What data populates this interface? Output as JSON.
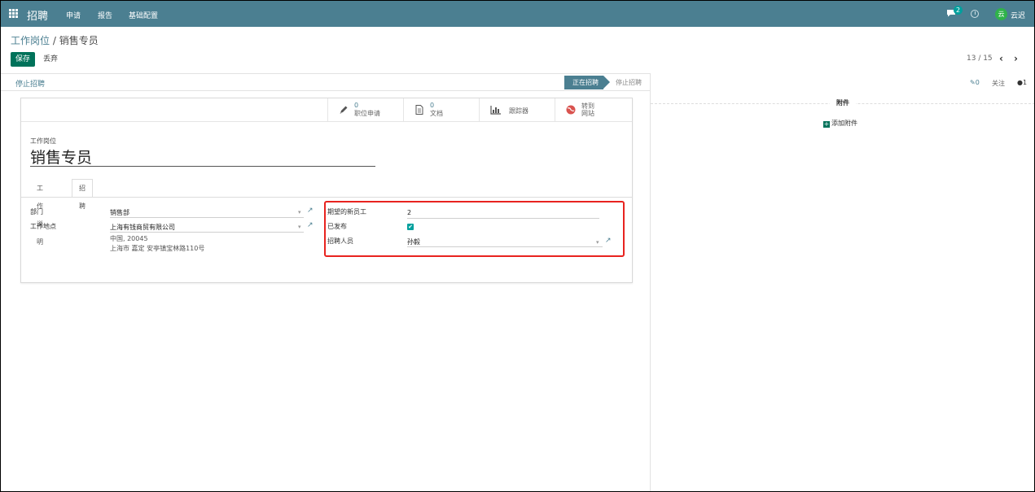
{
  "navbar": {
    "app_title": "招聘",
    "menu": [
      "申请",
      "报告",
      "基础配置"
    ],
    "chat_badge": "2",
    "avatar_text": "云",
    "username": "云迟"
  },
  "breadcrumb": {
    "parent": "工作岗位",
    "separator": " / ",
    "current": "销售专员"
  },
  "actions": {
    "save": "保存",
    "discard": "丢弃"
  },
  "pager": {
    "value": "13 / 15",
    "prev": "‹",
    "next": "›"
  },
  "statusbar": {
    "stop_button": "停止招聘",
    "stage_active": "正在招聘",
    "stage_next": "停止招聘"
  },
  "smart_buttons": {
    "applications": {
      "num": "0",
      "label": "职位申请",
      "icon": "pencil-icon"
    },
    "documents": {
      "num": "0",
      "label": "文档",
      "icon": "file-icon"
    },
    "tracker": {
      "label": "跟踪器",
      "icon": "bar-chart-icon"
    },
    "website": {
      "line1": "转到",
      "line2": "网站",
      "icon": "globe-icon"
    }
  },
  "form": {
    "job_label": "工作岗位",
    "job_title": "销售专员",
    "tabs": [
      "工作说明",
      "招聘"
    ],
    "left": {
      "department_label": "部门",
      "department_value": "销售部",
      "location_label": "工作地点",
      "location_value": "上海有钱商贸有限公司",
      "address_line1": "中国, 20045",
      "address_line2": "上海市 嘉定 安亭镇宝林路110号"
    },
    "right": {
      "expected_label": "期望的新员工",
      "expected_value": "2",
      "published_label": "已发布",
      "published_value": "✔",
      "recruiter_label": "招聘人员",
      "recruiter_value": "孙毅"
    }
  },
  "chatter": {
    "follow_count": "0",
    "follow": "关注",
    "followers": "1",
    "attachments_title": "附件",
    "add_attachment": "添加附件"
  },
  "colors": {
    "navbar": "#4b7f91",
    "save_button": "#00725a",
    "highlight_border": "#e8231f",
    "checkbox": "#00a09d"
  }
}
